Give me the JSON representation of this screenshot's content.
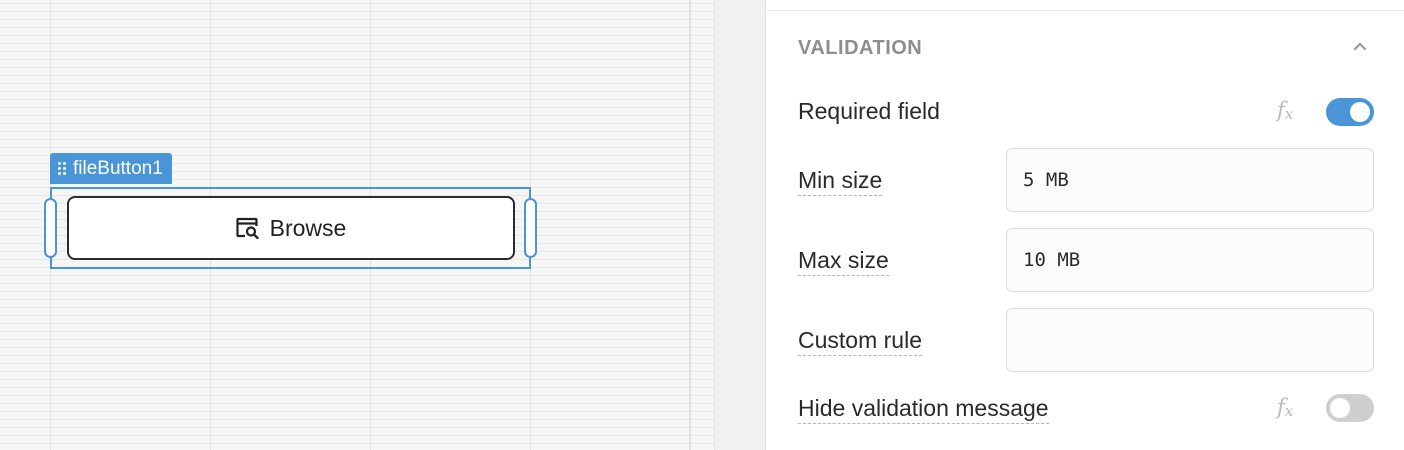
{
  "canvas": {
    "component": {
      "name": "fileButton1",
      "button_label": "Browse"
    }
  },
  "panel": {
    "section_title": "VALIDATION",
    "required_field": {
      "label": "Required field",
      "fx": "f",
      "fx_sub": "x",
      "enabled": true
    },
    "min_size": {
      "label": "Min size",
      "value": "5 MB"
    },
    "max_size": {
      "label": "Max size",
      "value": "10 MB"
    },
    "custom_rule": {
      "label": "Custom rule",
      "value": ""
    },
    "hide_validation_message": {
      "label": "Hide validation message",
      "fx": "f",
      "fx_sub": "x",
      "enabled": false
    }
  },
  "colors": {
    "accent": "#4a95d7",
    "toggle_off": "#cfcfcf",
    "section_title": "#8e8e8e"
  },
  "icons": [
    "drag-handle-icon",
    "file-search-icon",
    "chevron-up-icon",
    "fx-icon"
  ]
}
